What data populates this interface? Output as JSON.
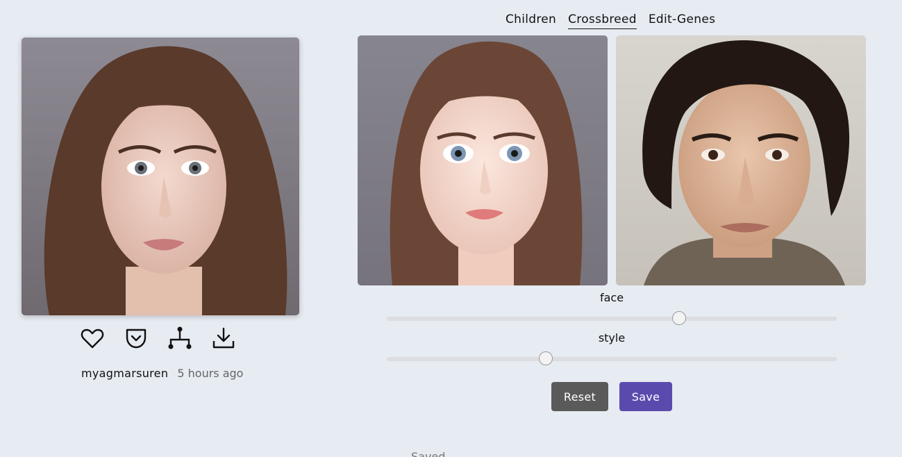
{
  "card": {
    "photo_alt": "",
    "actions": [
      {
        "icon": "heart-icon"
      },
      {
        "icon": "pocket-save-icon"
      },
      {
        "icon": "family-tree-icon"
      },
      {
        "icon": "download-icon"
      }
    ],
    "username": "myagmarsuren",
    "time": "5 hours ago"
  },
  "tabs": [
    {
      "label": "Children",
      "active": false
    },
    {
      "label": "Crossbreed",
      "active": true
    },
    {
      "label": "Edit-Genes",
      "active": false
    }
  ],
  "sliders": {
    "face": {
      "label": "face",
      "value": 0.65
    },
    "style": {
      "label": "style",
      "value": 0.354
    }
  },
  "buttons": {
    "reset": "Reset",
    "save": "Save"
  },
  "status": {
    "saved": "Saved"
  },
  "colors": {
    "background": "#e7ebf2",
    "save_button": "#5b4aae",
    "reset_button": "#5a5a5a"
  }
}
